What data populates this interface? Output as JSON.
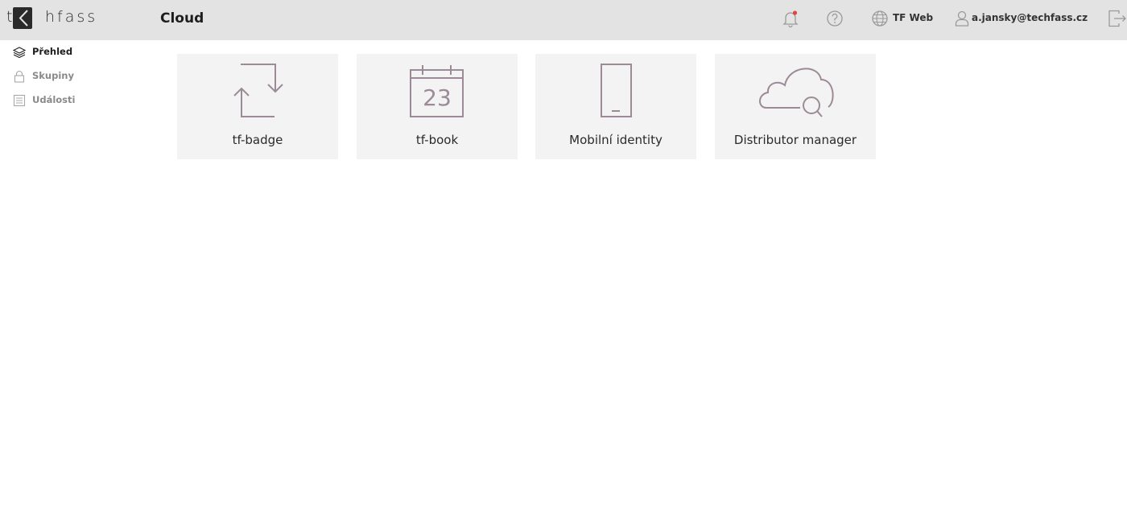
{
  "brand": {
    "logo_left": "te",
    "logo_right": "hfass"
  },
  "header": {
    "title": "Cloud",
    "tfweb_label": "TF Web",
    "user_email": "a.jansky@techfass.cz",
    "icons": [
      "bell-icon",
      "help-icon",
      "globe-icon",
      "user-icon",
      "logout-icon"
    ],
    "notification_dot_color": "#e0453f"
  },
  "sidebar": {
    "items": [
      {
        "label": "Přehled",
        "icon": "layers-icon",
        "active": true
      },
      {
        "label": "Skupiny",
        "icon": "lock-icon",
        "active": false
      },
      {
        "label": "Události",
        "icon": "list-icon",
        "active": false
      }
    ]
  },
  "tiles": [
    {
      "label": "tf-badge",
      "icon": "swap-arrows-icon"
    },
    {
      "label": "tf-book",
      "icon": "calendar-icon",
      "icon_text": "23"
    },
    {
      "label": "Mobilní identity",
      "icon": "phone-icon"
    },
    {
      "label": "Distributor manager",
      "icon": "cloud-search-icon"
    }
  ],
  "colors": {
    "accent_icon": "#9c8b97",
    "topbar_bg": "#e3e3e3",
    "tile_bg": "#f3f3f3"
  }
}
